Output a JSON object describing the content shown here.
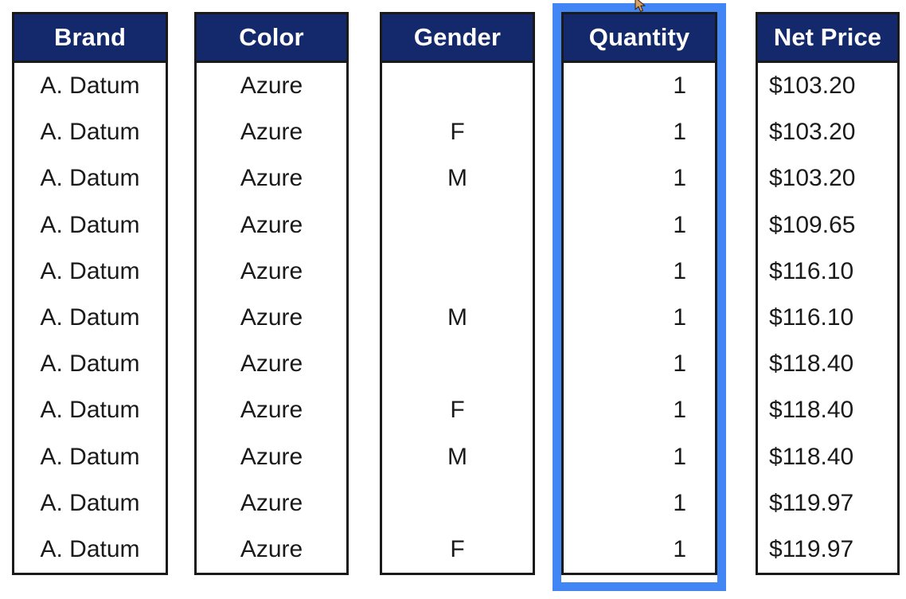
{
  "table": {
    "columns": [
      {
        "id": "brand",
        "header": "Brand",
        "align": "center",
        "selected": false
      },
      {
        "id": "color",
        "header": "Color",
        "align": "center",
        "selected": false
      },
      {
        "id": "gender",
        "header": "Gender",
        "align": "center",
        "selected": false
      },
      {
        "id": "quantity",
        "header": "Quantity",
        "align": "right",
        "selected": true
      },
      {
        "id": "netprice",
        "header": "Net Price",
        "align": "left",
        "selected": false
      }
    ],
    "row_count": 11,
    "rows": [
      {
        "brand": "A. Datum",
        "color": "Azure",
        "gender": "",
        "quantity": "1",
        "netprice": "$103.20"
      },
      {
        "brand": "A. Datum",
        "color": "Azure",
        "gender": "F",
        "quantity": "1",
        "netprice": "$103.20"
      },
      {
        "brand": "A. Datum",
        "color": "Azure",
        "gender": "M",
        "quantity": "1",
        "netprice": "$103.20"
      },
      {
        "brand": "A. Datum",
        "color": "Azure",
        "gender": "",
        "quantity": "1",
        "netprice": "$109.65"
      },
      {
        "brand": "A. Datum",
        "color": "Azure",
        "gender": "",
        "quantity": "1",
        "netprice": "$116.10"
      },
      {
        "brand": "A. Datum",
        "color": "Azure",
        "gender": "M",
        "quantity": "1",
        "netprice": "$116.10"
      },
      {
        "brand": "A. Datum",
        "color": "Azure",
        "gender": "",
        "quantity": "1",
        "netprice": "$118.40"
      },
      {
        "brand": "A. Datum",
        "color": "Azure",
        "gender": "F",
        "quantity": "1",
        "netprice": "$118.40"
      },
      {
        "brand": "A. Datum",
        "color": "Azure",
        "gender": "M",
        "quantity": "1",
        "netprice": "$118.40"
      },
      {
        "brand": "A. Datum",
        "color": "Azure",
        "gender": "",
        "quantity": "1",
        "netprice": "$119.97"
      },
      {
        "brand": "A. Datum",
        "color": "Azure",
        "gender": "F",
        "quantity": "1",
        "netprice": "$119.97"
      }
    ]
  },
  "selection": {
    "selected_column": "Quantity",
    "highlight_color": "#4285f4"
  },
  "colors": {
    "header_background": "#14296b",
    "header_text": "#ffffff",
    "cell_text": "#1a1a1a",
    "cell_background": "#ffffff",
    "border": "#1a1a1a",
    "selection": "#4285f4"
  },
  "cursor": {
    "icon": "mouse-pointer-icon"
  }
}
